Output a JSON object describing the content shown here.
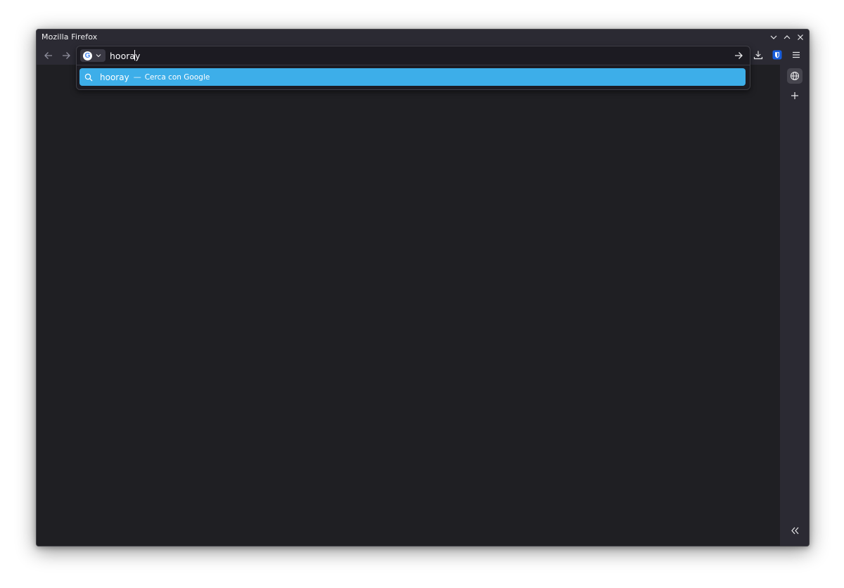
{
  "window": {
    "title": "Mozilla Firefox"
  },
  "urlbar": {
    "value": "hooray",
    "search_engine": "Google"
  },
  "suggestions": [
    {
      "query": "hooray",
      "separator": "—",
      "action": "Cerca con Google",
      "icon": "search-icon"
    }
  ],
  "toolbar": {
    "icons": [
      "back-arrow-icon",
      "forward-arrow-icon",
      "go-arrow-icon",
      "download-icon",
      "bitwarden-shield-icon",
      "hamburger-menu-icon"
    ]
  },
  "sidebar": {
    "icons": [
      "globe-icon",
      "plus-icon",
      "double-chevron-left-icon"
    ]
  },
  "colors": {
    "window_bg": "#1f1f23",
    "chrome_bg": "#2b2a33",
    "highlight": "#3daee9",
    "bitwarden": "#175ddc"
  }
}
